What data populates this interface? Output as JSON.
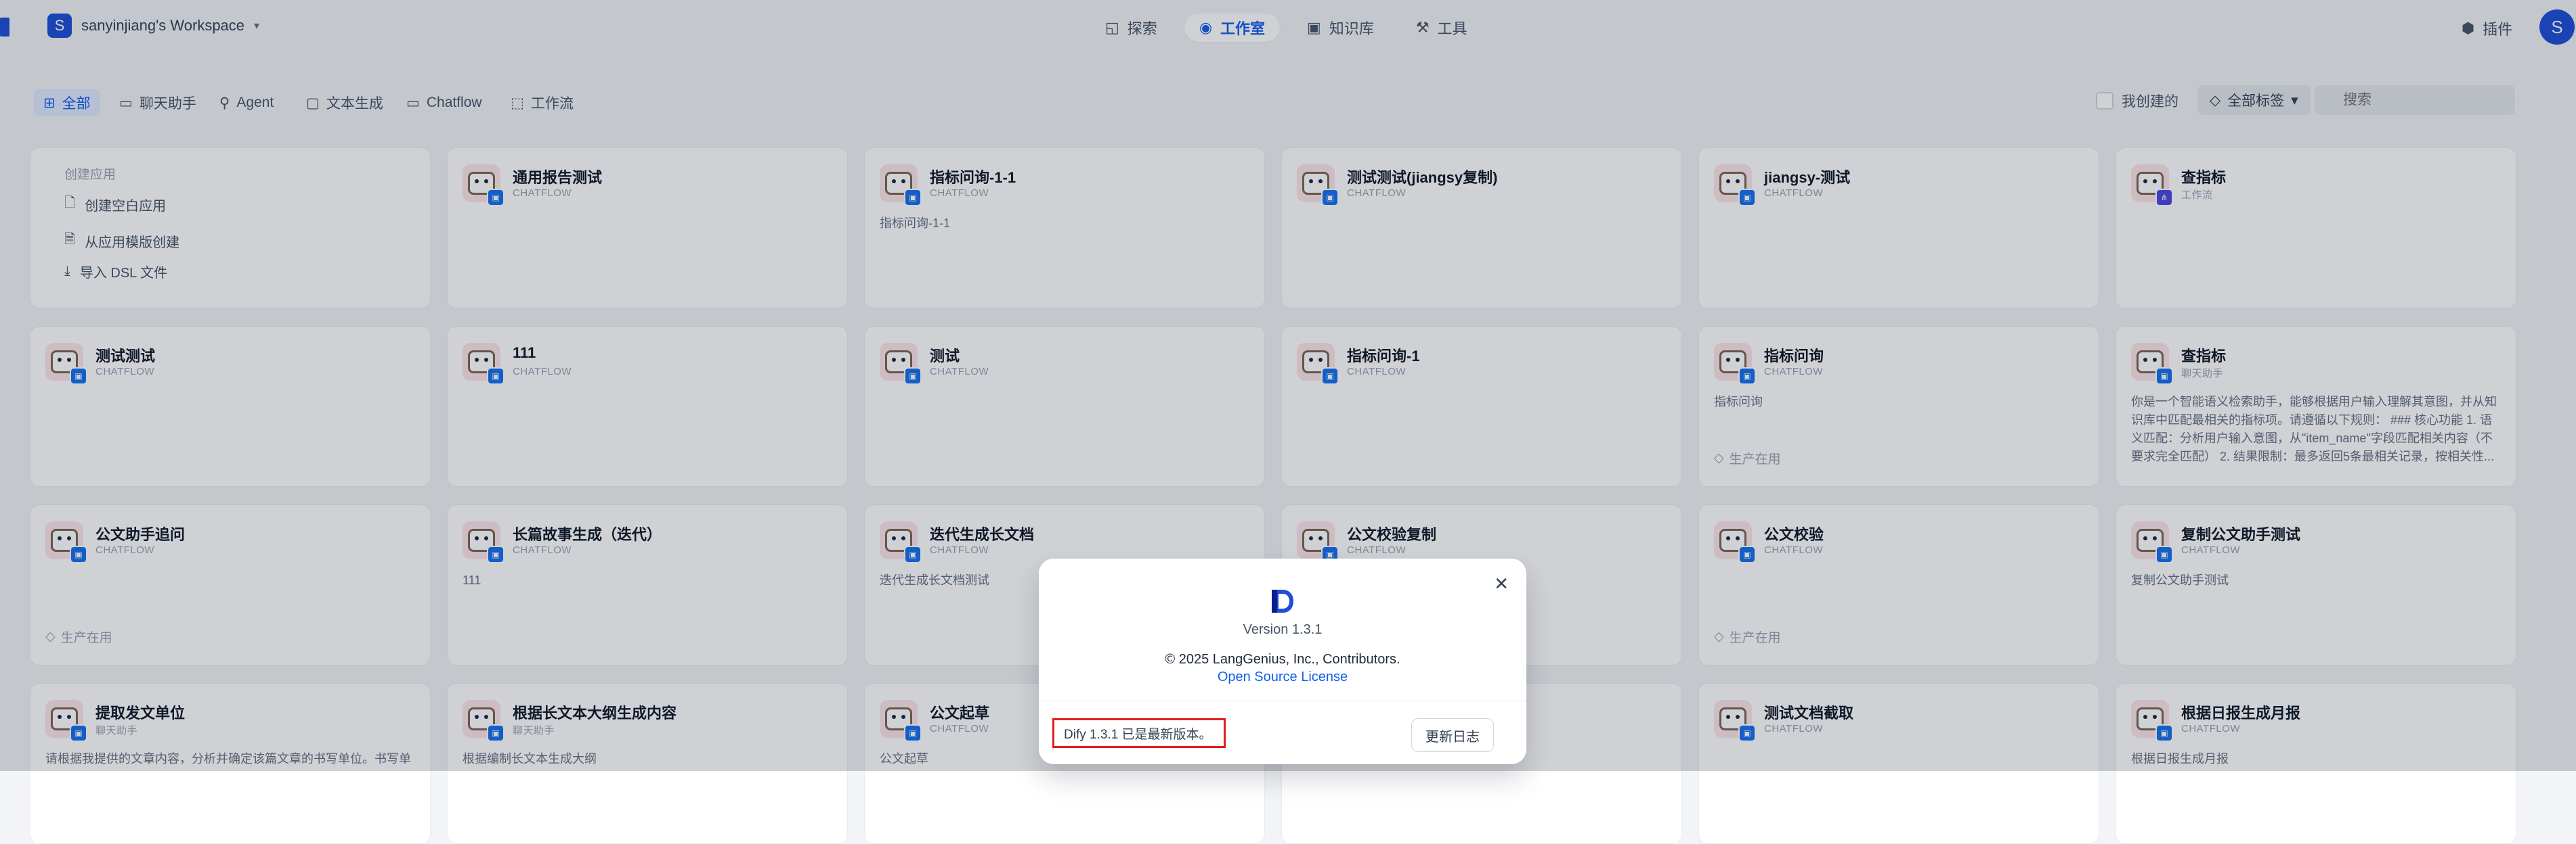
{
  "header": {
    "workspace_initial": "S",
    "workspace_name": "sanyinjiang's Workspace",
    "nav": [
      {
        "label": "探索",
        "icon": "compass-icon"
      },
      {
        "label": "工作室",
        "icon": "robot-icon",
        "active": true
      },
      {
        "label": "知识库",
        "icon": "book-icon"
      },
      {
        "label": "工具",
        "icon": "wrench-icon"
      }
    ],
    "plugins_label": "插件",
    "user_initial": "S"
  },
  "filters": {
    "tabs": [
      "全部",
      "聊天助手",
      "Agent",
      "文本生成",
      "Chatflow",
      "工作流"
    ],
    "active_tab": "全部",
    "mine_label": "我创建的",
    "tags_label": "全部标签",
    "search_placeholder": "搜索"
  },
  "create": {
    "title": "创建应用",
    "blank": "创建空白应用",
    "template": "从应用模版创建",
    "import": "导入 DSL 文件"
  },
  "apps": [
    {
      "name": "通用报告测试",
      "type": "CHATFLOW",
      "desc": "",
      "tag": ""
    },
    {
      "name": "指标问询-1-1",
      "type": "CHATFLOW",
      "desc": "指标问询-1-1",
      "tag": ""
    },
    {
      "name": "测试测试(jiangsy复制)",
      "type": "CHATFLOW",
      "desc": "",
      "tag": ""
    },
    {
      "name": "jiangsy-测试",
      "type": "CHATFLOW",
      "desc": "",
      "tag": ""
    },
    {
      "name": "查指标",
      "type": "工作流",
      "desc": "",
      "tag": ""
    },
    {
      "name": "测试测试",
      "type": "CHATFLOW",
      "desc": "",
      "tag": ""
    },
    {
      "name": "111",
      "type": "CHATFLOW",
      "desc": "",
      "tag": ""
    },
    {
      "name": "测试",
      "type": "CHATFLOW",
      "desc": "",
      "tag": ""
    },
    {
      "name": "指标问询-1",
      "type": "CHATFLOW",
      "desc": "",
      "tag": ""
    },
    {
      "name": "指标问询",
      "type": "CHATFLOW",
      "desc": "指标问询",
      "tag": "生产在用"
    },
    {
      "name": "查指标",
      "type": "聊天助手",
      "desc": "你是一个智能语义检索助手，能够根据用户输入理解其意图，并从知识库中匹配最相关的指标项。请遵循以下规则： ### 核心功能 1. 语义匹配：分析用户输入意图，从\"item_name\"字段匹配相关内容（不要求完全匹配） 2. 结果限制：最多返回5条最相关记录，按相关性...",
      "tag": ""
    },
    {
      "name": "公文助手追问",
      "type": "CHATFLOW",
      "desc": "",
      "tag": "生产在用"
    },
    {
      "name": "长篇故事生成（迭代）",
      "type": "CHATFLOW",
      "desc": "111",
      "tag": ""
    },
    {
      "name": "迭代生成长文档",
      "type": "CHATFLOW",
      "desc": "迭代生成长文档测试",
      "tag": ""
    },
    {
      "name": "公文校验复制",
      "type": "CHATFLOW",
      "desc": "",
      "tag": ""
    },
    {
      "name": "公文校验",
      "type": "CHATFLOW",
      "desc": "",
      "tag": "生产在用"
    },
    {
      "name": "复制公文助手测试",
      "type": "CHATFLOW",
      "desc": "复制公文助手测试",
      "tag": ""
    },
    {
      "name": "提取发文单位",
      "type": "聊天助手",
      "desc": "请根据我提供的文章内容，分析并确定该篇文章的书写单位。书写单",
      "tag": ""
    },
    {
      "name": "根据长文本大纲生成内容",
      "type": "聊天助手",
      "desc": "根据编制长文本生成大纲",
      "tag": ""
    },
    {
      "name": "公文起草",
      "type": "CHATFLOW",
      "desc": "公文起草",
      "tag": ""
    },
    {
      "name": "",
      "type": "CHATFLOW",
      "desc": "",
      "tag": ""
    },
    {
      "name": "测试文档截取",
      "type": "CHATFLOW",
      "desc": "",
      "tag": ""
    },
    {
      "name": "根据日报生成月报",
      "type": "CHATFLOW",
      "desc": "根据日报生成月报",
      "tag": ""
    }
  ],
  "modal": {
    "version": "Version 1.3.1",
    "copyright": "© 2025 LangGenius, Inc., Contributors.",
    "license": "Open Source License",
    "latest_notice": "Dify 1.3.1 已是最新版本。",
    "changelog_button": "更新日志",
    "accent_color": "#155eef",
    "highlight_color": "#e11d1d"
  }
}
